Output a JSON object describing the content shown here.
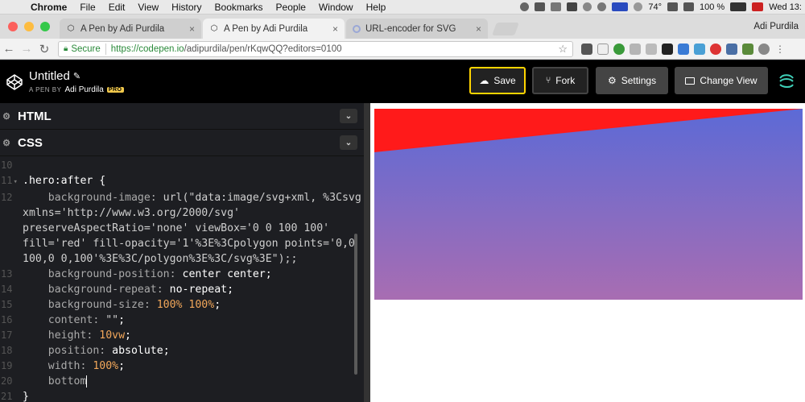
{
  "menubar": {
    "app": "Chrome",
    "items": [
      "File",
      "Edit",
      "View",
      "History",
      "Bookmarks",
      "People",
      "Window",
      "Help"
    ],
    "temperature": "74°",
    "battery": "100 %",
    "clock": "Wed 13:"
  },
  "tabs": [
    {
      "label": "A Pen by Adi Purdila",
      "active": false
    },
    {
      "label": "A Pen by Adi Purdila",
      "active": true
    },
    {
      "label": "URL-encoder for SVG",
      "active": false
    }
  ],
  "profile_name": "Adi Purdila",
  "omnibox": {
    "secure_label": "Secure",
    "url_host": "https://codepen.io",
    "url_rest": "/adipurdila/pen/rKqwQQ?editors=0100"
  },
  "pen": {
    "title": "Untitled",
    "by_label": "A PEN BY",
    "author": "Adi Purdila",
    "badge": "PRO"
  },
  "buttons": {
    "save": "Save",
    "fork": "Fork",
    "settings": "Settings",
    "change_view": "Change View"
  },
  "panels": {
    "html": "HTML",
    "css": "CSS"
  },
  "code_lines": {
    "l10": "10",
    "l11": "11",
    "l12": "12",
    "l13": "13",
    "l14": "14",
    "l15": "15",
    "l16": "16",
    "l17": "17",
    "l18": "18",
    "l19": "19",
    "l20": "20",
    "l21": "21",
    "selector_hero": ".hero",
    "selector_after": ":after",
    "open_brace": " {",
    "bg_image_prop": "    background-image: ",
    "bg_image_val1": "url(\"data:image/svg+xml, %3Csvg",
    "bg_image_val2": "xmlns='http://www.w3.org/2000/svg'",
    "bg_image_val3": "preserveAspectRatio='none' viewBox='0 0 100 100'",
    "bg_image_val4": "fill='red' fill-opacity='1'%3E%3Cpolygon points='0,0",
    "bg_image_val5": "100,0 0,100'%3E%3C/polygon%3E%3C/svg%3E\");;",
    "bg_pos_prop": "    background-position: ",
    "bg_pos_val": "center center",
    "bg_repeat_prop": "    background-repeat: ",
    "bg_repeat_val": "no-repeat",
    "bg_size_prop": "    background-size: ",
    "bg_size_val": "100% 100%",
    "content_prop": "    content: ",
    "content_val": "\"\"",
    "height_prop": "    height: ",
    "height_val": "10vw",
    "position_prop": "    position: ",
    "position_val": "absolute",
    "width_prop": "    width: ",
    "width_val": "100%",
    "bottom_prop": "    bottom",
    "close_brace": "}",
    "semicolon": ";"
  },
  "colors": {
    "hero_top": "#5c6ad6",
    "hero_bottom": "#a86db2",
    "hero_triangle": "#ff0000",
    "save_border": "#ffd400"
  }
}
